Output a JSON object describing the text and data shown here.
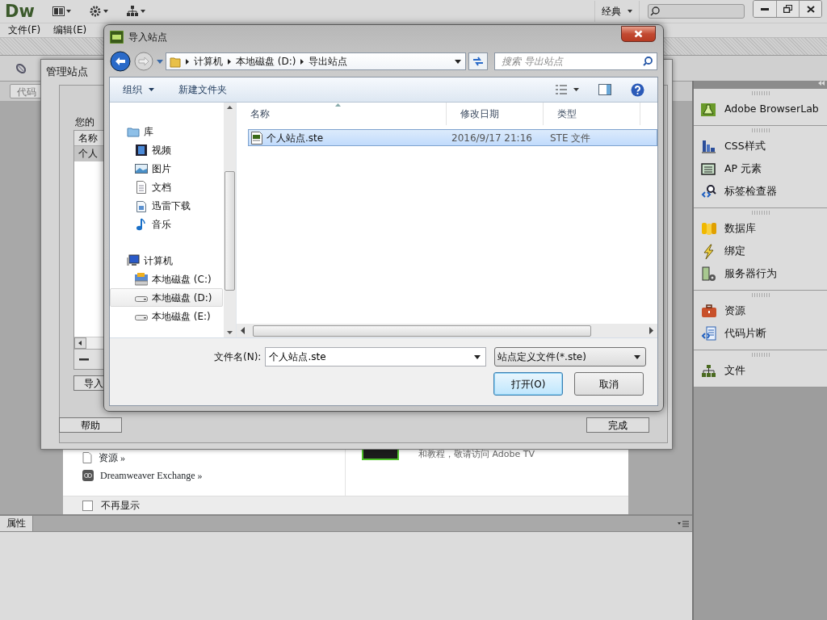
{
  "app": {
    "logo": "Dw",
    "workspace": "经典",
    "menu": [
      "文件(F)",
      "编辑(E)"
    ],
    "code_button": "代码"
  },
  "welcome": {
    "links": [
      "资源 »",
      "Dreamweaver Exchange »"
    ],
    "promo_text": "和教程，敬请访问 Adobe TV",
    "dont_show": {
      "label": "不再显示",
      "checked": false
    }
  },
  "properties_panel": {
    "title": "属性"
  },
  "side_panel": {
    "groups": [
      {
        "items": [
          "Adobe BrowserLab"
        ]
      },
      {
        "items": [
          "CSS样式",
          "AP 元素",
          "标签检查器"
        ]
      },
      {
        "items": [
          "数据库",
          "绑定",
          "服务器行为"
        ]
      },
      {
        "items": [
          "资源",
          "代码片断"
        ]
      },
      {
        "items": [
          "文件"
        ]
      }
    ]
  },
  "manage_sites_dialog": {
    "title": "管理站点",
    "group_label": "您的",
    "column": "名称",
    "sites": [
      {
        "name": "个人",
        "selected": true
      }
    ],
    "import_button": "导入",
    "help_button": "帮助",
    "done_button": "完成"
  },
  "import_dialog": {
    "title": "导入站点",
    "breadcrumb": [
      "计算机",
      "本地磁盘 (D:)",
      "导出站点"
    ],
    "search_placeholder": "搜索 导出站点",
    "organize": "组织",
    "new_folder": "新建文件夹",
    "nav_tree": [
      {
        "label": "库",
        "selected": false,
        "children": [
          {
            "label": "视频",
            "selected": false
          },
          {
            "label": "图片",
            "selected": false
          },
          {
            "label": "文档",
            "selected": false
          },
          {
            "label": "迅雷下载",
            "selected": false
          },
          {
            "label": "音乐",
            "selected": false
          }
        ]
      },
      {
        "label": "计算机",
        "selected": false,
        "children": [
          {
            "label": "本地磁盘 (C:)",
            "selected": false
          },
          {
            "label": "本地磁盘 (D:)",
            "selected": true
          },
          {
            "label": "本地磁盘 (E:)",
            "selected": false
          }
        ]
      }
    ],
    "columns": [
      "名称",
      "修改日期",
      "类型"
    ],
    "files": [
      {
        "name": "个人站点.ste",
        "modified": "2016/9/17 21:16",
        "type": "STE 文件",
        "selected": true
      }
    ],
    "filename_label": "文件名(N):",
    "filename": "个人站点.ste",
    "filter": "站点定义文件(*.ste)",
    "buttons": [
      {
        "label": "打开(O)",
        "default": true
      },
      {
        "label": "取消",
        "default": false
      }
    ]
  }
}
